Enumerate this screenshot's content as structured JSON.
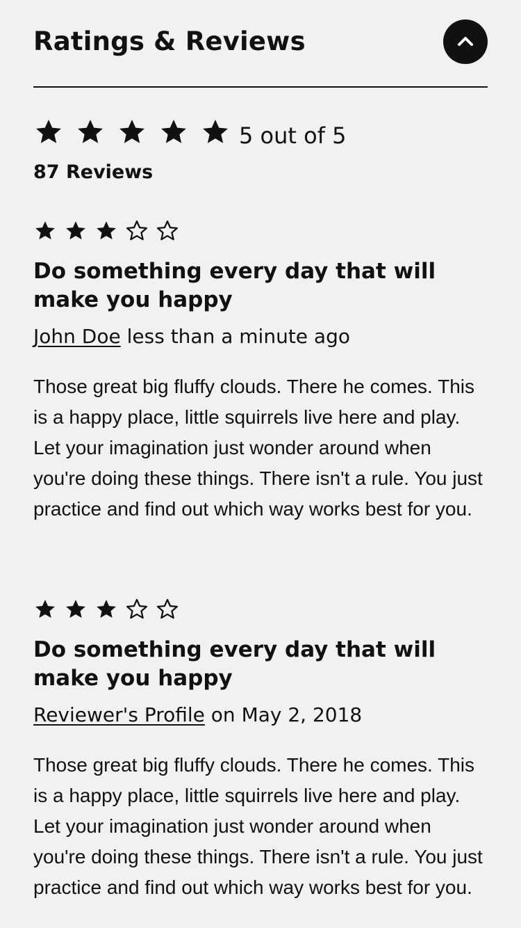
{
  "header": {
    "title": "Ratings & Reviews"
  },
  "summary": {
    "rating": 5,
    "max_rating": 5,
    "score_text": "5 out of 5",
    "review_count_text": "87 Reviews"
  },
  "reviews": [
    {
      "rating": 3,
      "max_rating": 5,
      "title": "Do something every day that will make you happy",
      "author": "John Doe",
      "date_text": "less than a minute ago",
      "body": "Those great big fluffy clouds. There he comes. This is a happy place, little squirrels live here and play. Let your imagination just wonder around when you're doing these things. There isn't a rule. You just practice and find out which way works best for you."
    },
    {
      "rating": 3,
      "max_rating": 5,
      "title": "Do something every day that will make you happy",
      "author": "Reviewer's Profile",
      "date_text": "on May 2, 2018",
      "body": "Those great big fluffy clouds. There he comes. This is a happy place, little squirrels live here and play. Let your imagination just wonder around when you're doing these things. There isn't a rule. You just practice and find out which way works best for you."
    }
  ],
  "icons": {
    "collapse": "chevron-up-icon",
    "filled_star": "star-filled-icon",
    "empty_star": "star-outline-icon"
  },
  "colors": {
    "background": "#f0f1f0",
    "text": "#111111"
  }
}
